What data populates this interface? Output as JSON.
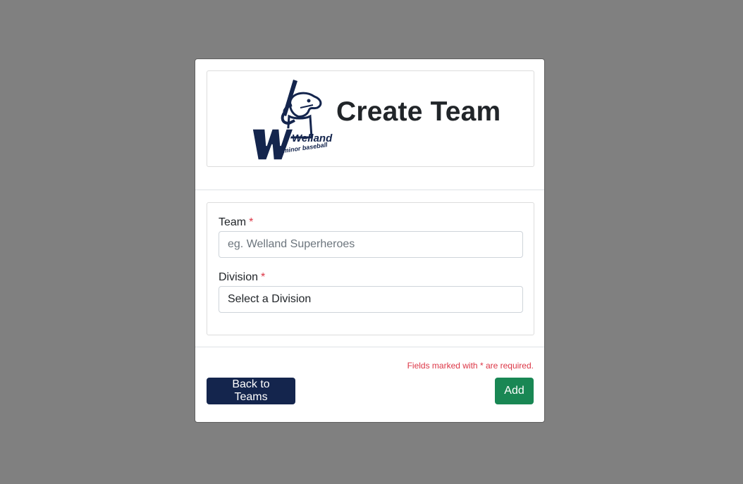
{
  "header": {
    "title": "Create Team",
    "logo": {
      "icon": "welland-minor-baseball-logo",
      "text_main": "Welland",
      "text_sub": "minor baseball",
      "color": "#14254d"
    }
  },
  "form": {
    "team": {
      "label": "Team",
      "required_mark": "*",
      "value": "",
      "placeholder": "eg. Welland Superheroes"
    },
    "division": {
      "label": "Division",
      "required_mark": "*",
      "selected": "Select a Division"
    }
  },
  "footer": {
    "required_note": "Fields marked with * are required.",
    "back_label": "Back to Teams",
    "add_label": "Add"
  },
  "colors": {
    "primary": "#14254d",
    "success": "#198754",
    "danger": "#dc3545",
    "backdrop": "#808080"
  }
}
